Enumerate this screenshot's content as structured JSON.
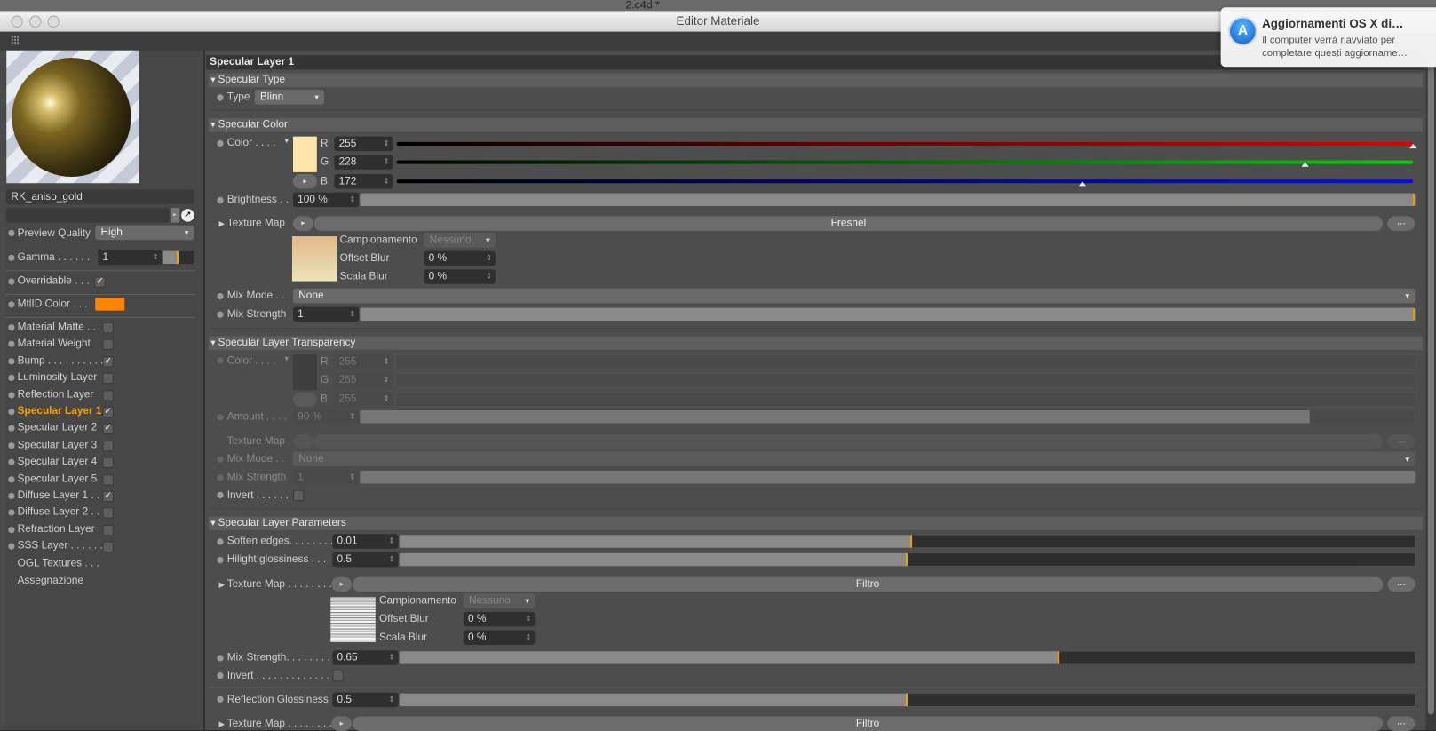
{
  "desktop_title": "2.c4d *",
  "window_title": "Editor Materiale",
  "notification": {
    "title": "Aggiornamenti OS X di…",
    "line1": "Il computer verrà riavviato per",
    "line2": "completare questi aggiorname…"
  },
  "left": {
    "material_name": "RK_aniso_gold",
    "preview_quality_label": "Preview Quality",
    "preview_quality_value": "High",
    "gamma_label": "Gamma . . . . . .",
    "gamma_value": "1",
    "overridable_label": "Overridable . . .",
    "mtlid_label": "MtlID Color . . .",
    "mtlid_color": "#ff8400",
    "channels": [
      {
        "label": "Material Matte . .",
        "checked": false
      },
      {
        "label": "Material Weight",
        "checked": false
      },
      {
        "label": "Bump . . . . . . . . . .",
        "checked": true
      },
      {
        "label": "Luminosity Layer",
        "checked": false
      },
      {
        "label": "Reflection Layer",
        "checked": false
      },
      {
        "label": "Specular Layer 1",
        "checked": true,
        "active": true
      },
      {
        "label": "Specular Layer 2",
        "checked": true
      },
      {
        "label": "Specular Layer 3",
        "checked": false
      },
      {
        "label": "Specular Layer 4",
        "checked": false
      },
      {
        "label": "Specular Layer 5",
        "checked": false
      },
      {
        "label": "Diffuse Layer 1 . .",
        "checked": true
      },
      {
        "label": "Diffuse Layer 2 . .",
        "checked": false
      },
      {
        "label": "Refraction Layer",
        "checked": false
      },
      {
        "label": "SSS Layer . . . . . . .",
        "checked": false
      }
    ],
    "ogl_label": "OGL Textures . . .",
    "assign_label": "Assegnazione"
  },
  "main": {
    "header": "Specular Layer 1",
    "spec_type": {
      "title": "Specular Type",
      "type_label": "Type",
      "type_value": "Blinn"
    },
    "spec_color": {
      "title": "Specular Color",
      "color_label": "Color . . . .",
      "swatch": "#ffe4ac",
      "r_label": "R",
      "r": "255",
      "g_label": "G",
      "g": "228",
      "b_label": "B",
      "b": "172",
      "r_frac": 1.0,
      "g_frac": 0.894,
      "b_frac": 0.675,
      "brightness_label": "Brightness . .",
      "brightness": "100 %",
      "brightness_frac": 1.0,
      "texture_label": "Texture Map",
      "texture_name": "Fresnel",
      "more": "...",
      "sampling_label": "Campionamento",
      "sampling_value": "Nessuno",
      "offset_label": "Offset Blur",
      "offset_value": "0 %",
      "scale_label": "Scala Blur",
      "scale_value": "0 %",
      "mixmode_label": "Mix Mode . .",
      "mixmode_value": "None",
      "mixstrength_label": "Mix Strength",
      "mixstrength_value": "1",
      "mixstrength_frac": 1.0
    },
    "transparency": {
      "title": "Specular Layer Transparency",
      "color_label": "Color . . . .",
      "r_label": "R",
      "r": "255",
      "g_label": "G",
      "g": "255",
      "b_label": "B",
      "b": "255",
      "amount_label": "Amount . . . .",
      "amount": "90 %",
      "amount_frac": 0.9,
      "texture_label": "Texture Map",
      "more": "...",
      "mixmode_label": "Mix Mode . .",
      "mixmode_value": "None",
      "mixstrength_label": "Mix Strength",
      "mixstrength_value": "1",
      "mixstrength_frac": 1.0,
      "invert_label": "Invert . . . . . ."
    },
    "params": {
      "title": "Specular Layer Parameters",
      "soften_label": "Soften edges. . . . . . . .",
      "soften_value": "0.01",
      "soften_frac": 0.505,
      "gloss_label": "Hilight glossiness . . .",
      "gloss_value": "0.5",
      "gloss_frac": 0.5,
      "texture_label": "Texture Map . . . . . . . .",
      "texture_name": "Filtro",
      "more": "...",
      "sampling_label": "Campionamento",
      "sampling_value": "Nessuno",
      "offset_label": "Offset Blur",
      "offset_value": "0 %",
      "scale_label": "Scala Blur",
      "scale_value": "0 %",
      "mixstrength_label": "Mix Strength. . . . . . . .",
      "mixstrength_value": "0.65",
      "mixstrength_frac": 0.65,
      "invert_label": "Invert . . . . . . . . . . . . . .",
      "refl_label": "Reflection Glossiness",
      "refl_value": "0.5",
      "refl_frac": 0.5,
      "texture2_label": "Texture Map . . . . . . . .",
      "texture2_name": "Filtro"
    }
  }
}
